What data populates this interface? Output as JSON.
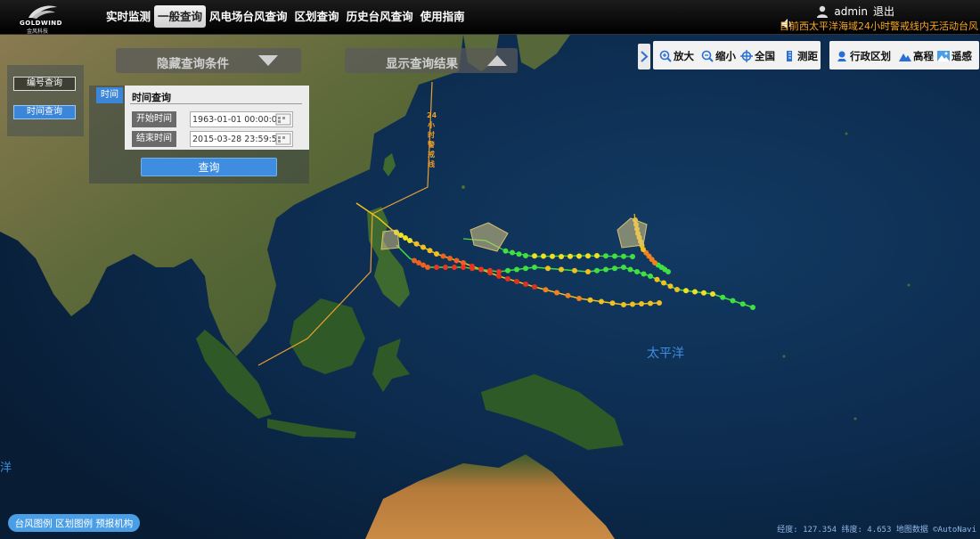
{
  "header": {
    "logo_text": "GOLDWIND",
    "logo_sub": "金风科技",
    "nav": [
      {
        "label": "实时监测",
        "active": false
      },
      {
        "label": "一般查询",
        "active": true
      },
      {
        "label": "风电场台风查询",
        "active": false
      },
      {
        "label": "区划查询",
        "active": false
      },
      {
        "label": "历史台风查询",
        "active": false
      },
      {
        "label": "使用指南",
        "active": false
      }
    ],
    "username": "admin",
    "logout": "退出",
    "alert": "目前西太平洋海域24小时警戒线内无活动台风"
  },
  "side_tabs": {
    "number_query": "编号查询",
    "time_query": "时间查询"
  },
  "banners": {
    "hide_conditions": "隐藏查询条件",
    "show_results": "显示查询结果"
  },
  "query_form": {
    "tab": "时间",
    "title": "时间查询",
    "start_label": "开始时间",
    "start_value": "1963-01-01 00:00:00",
    "end_label": "结束时间",
    "end_value": "2015-03-28 23:59:59",
    "submit": "查询"
  },
  "toolbar": {
    "zoom_in": "放大",
    "zoom_out": "缩小",
    "full_country": "全国",
    "measure": "测距",
    "admin_division": "行政区划",
    "elevation": "高程",
    "remote_sensing": "遥感"
  },
  "map": {
    "ocean_label": "太平洋",
    "ocean_label_fragment": "洋",
    "warning_line_label": "24小时警戒线"
  },
  "legend": {
    "typhoon_legend": "台风图例",
    "region_legend": "区划图例",
    "forecast_agency": "预报机构"
  },
  "status": {
    "coords": "经度: 127.354 纬度: 4.653",
    "map_data": "地图数据 ©AutoNavi"
  },
  "colors": {
    "accent": "#3f8de0",
    "alert": "#f5a623",
    "warning_line": "#e89b2a"
  }
}
